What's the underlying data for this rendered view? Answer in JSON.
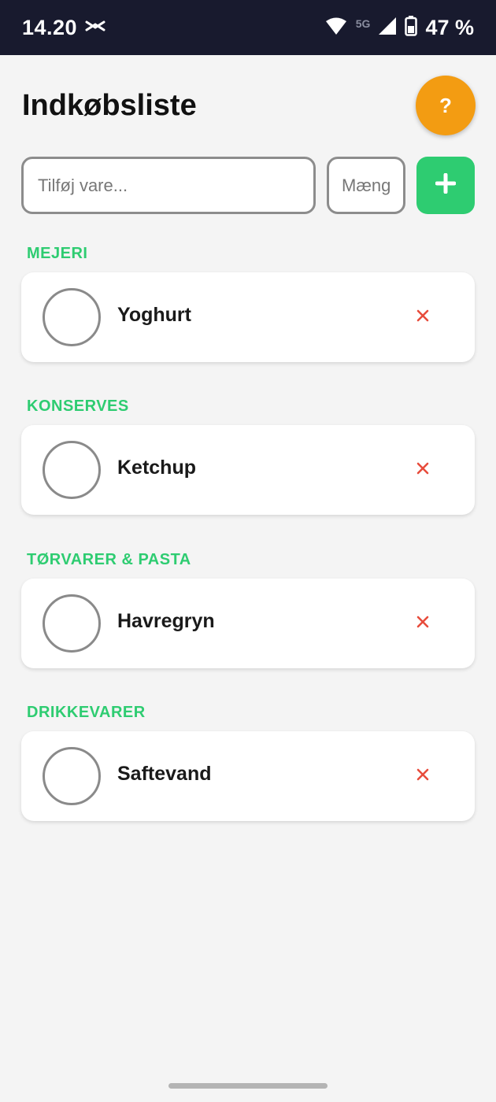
{
  "status_bar": {
    "time": "14.20",
    "network": "5G",
    "battery": "47 %"
  },
  "header": {
    "title": "Indkøbsliste",
    "help_label": "?"
  },
  "add_form": {
    "item_placeholder": "Tilføj vare...",
    "item_value": "",
    "quantity_placeholder": "Mængde",
    "quantity_value": "",
    "add_icon": "plus-icon"
  },
  "categories": [
    {
      "name": "MEJERI",
      "items": [
        {
          "name": "Yoghurt",
          "checked": false
        }
      ]
    },
    {
      "name": "KONSERVES",
      "items": [
        {
          "name": "Ketchup",
          "checked": false
        }
      ]
    },
    {
      "name": "TØRVARER & PASTA",
      "items": [
        {
          "name": "Havregryn",
          "checked": false
        }
      ]
    },
    {
      "name": "DRIKKEVARER",
      "items": [
        {
          "name": "Saftevand",
          "checked": false
        }
      ]
    }
  ],
  "colors": {
    "accent_green": "#2ecc71",
    "help_orange": "#f39c12",
    "delete_red": "#e74c3c",
    "status_bar_bg": "#181a2e",
    "page_bg": "#f4f4f4"
  }
}
